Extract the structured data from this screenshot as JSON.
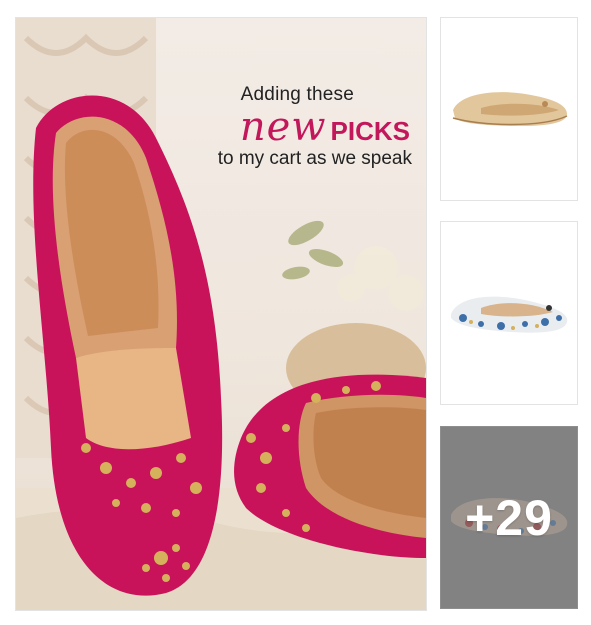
{
  "collection": {
    "hero": {
      "line1": "Adding these",
      "line2_script": "new",
      "line2_caps": "PICKS",
      "line3": "to my cart as we speak"
    },
    "thumbnails": [
      {
        "icon": "beige-juti-image"
      },
      {
        "icon": "floral-juti-image"
      },
      {
        "icon": "embroidered-juti-image"
      }
    ],
    "more_count": "+29"
  },
  "colors": {
    "accent": "#c2185b",
    "shoe_pink": "#c8135a",
    "overlay_gray": "#8e8e8e"
  }
}
